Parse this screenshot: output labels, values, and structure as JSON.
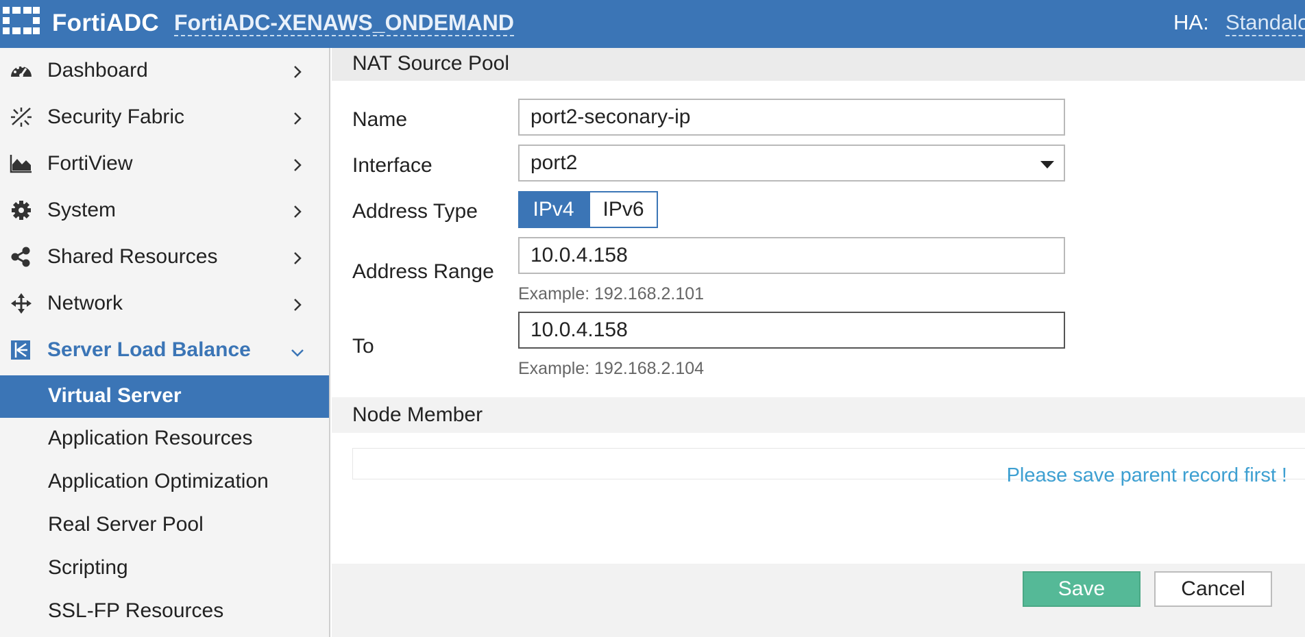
{
  "topbar": {
    "brand": "FortiADC",
    "hostname": "FortiADC-XENAWS_ONDEMAND",
    "ha_label": "HA:",
    "ha_value": "Standalo",
    "brand_color": "#3b75b6"
  },
  "sidebar": {
    "items": [
      {
        "label": "Dashboard",
        "icon": "dashboard-icon"
      },
      {
        "label": "Security Fabric",
        "icon": "security-fabric-icon"
      },
      {
        "label": "FortiView",
        "icon": "area-chart-icon"
      },
      {
        "label": "System",
        "icon": "gear-icon"
      },
      {
        "label": "Shared Resources",
        "icon": "share-icon"
      },
      {
        "label": "Network",
        "icon": "move-arrows-icon"
      },
      {
        "label": "Server Load Balance",
        "icon": "load-balance-icon",
        "expanded": true
      }
    ],
    "sub_items": [
      {
        "label": "Virtual Server",
        "selected": true
      },
      {
        "label": "Application Resources"
      },
      {
        "label": "Application Optimization"
      },
      {
        "label": "Real Server Pool"
      },
      {
        "label": "Scripting"
      },
      {
        "label": "SSL-FP Resources"
      }
    ]
  },
  "form": {
    "section_title": "NAT Source Pool",
    "name_label": "Name",
    "name_value": "port2-seconary-ip",
    "interface_label": "Interface",
    "interface_value": "port2",
    "address_type_label": "Address Type",
    "address_type_options": [
      "IPv4",
      "IPv6"
    ],
    "address_type_selected": "IPv4",
    "address_range_label": "Address Range",
    "address_range_value": "10.0.4.158",
    "address_range_hint": "Example: 192.168.2.101",
    "to_label": "To",
    "to_value": "10.0.4.158",
    "to_hint": "Example: 192.168.2.104"
  },
  "node_member": {
    "title": "Node Member",
    "notice": "Please save parent record first !"
  },
  "footer": {
    "save_label": "Save",
    "cancel_label": "Cancel",
    "save_color": "#55b997"
  }
}
